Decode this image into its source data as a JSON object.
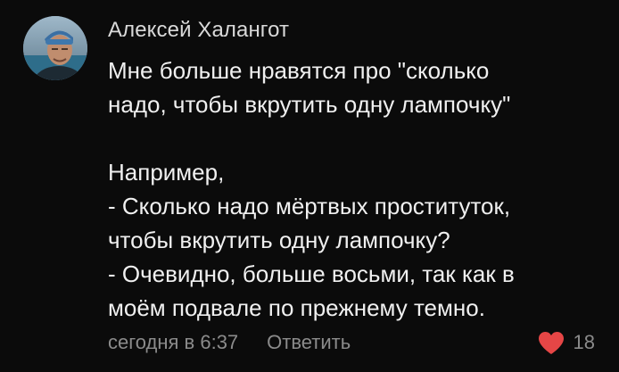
{
  "comment": {
    "author": "Алексей Халангот",
    "lines": [
      "Мне больше нравятся про \"сколько",
      "надо, чтобы вкрутить одну лампочку\"",
      "",
      "Например,",
      "- Сколько надо мёртвых проституток,",
      "чтобы вкрутить одну лампочку?",
      "- Очевидно, больше восьми, так как в",
      "моём подвале по прежнему темно."
    ],
    "timestamp": "сегодня в 6:37",
    "reply_label": "Ответить",
    "like_count": "18",
    "avatar_icon": "user-avatar",
    "like_icon": "heart-icon"
  },
  "colors": {
    "background": "#0b0b0b",
    "author": "#d9d9d9",
    "text": "#f0f0f0",
    "meta": "#8b8b8b",
    "heart": "#e64646"
  }
}
